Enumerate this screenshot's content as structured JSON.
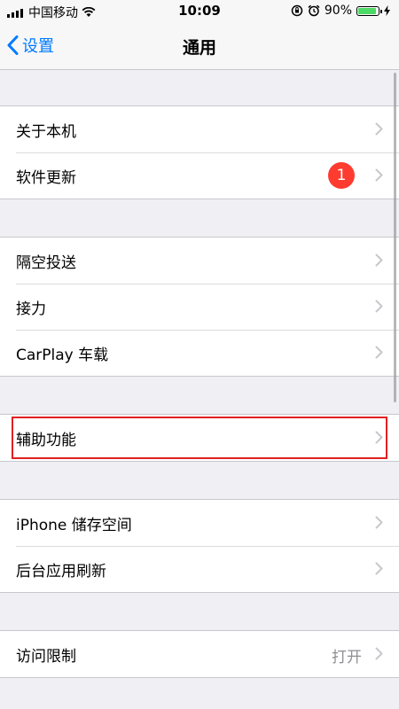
{
  "status_bar": {
    "carrier": "中国移动",
    "time": "10:09",
    "battery_text": "90%",
    "battery_level": 0.9
  },
  "nav": {
    "back_label": "设置",
    "title": "通用"
  },
  "groups": [
    {
      "items": [
        {
          "label": "关于本机"
        },
        {
          "label": "软件更新",
          "badge": "1"
        }
      ]
    },
    {
      "items": [
        {
          "label": "隔空投送"
        },
        {
          "label": "接力"
        },
        {
          "label": "CarPlay 车载"
        }
      ]
    },
    {
      "items": [
        {
          "label": "辅助功能",
          "highlighted": true
        }
      ]
    },
    {
      "items": [
        {
          "label": "iPhone 储存空间"
        },
        {
          "label": "后台应用刷新"
        }
      ]
    },
    {
      "items": [
        {
          "label": "访问限制",
          "value": "打开"
        }
      ]
    }
  ],
  "colors": {
    "accent": "#007aff",
    "badge": "#ff3b30",
    "highlight": "#e02020",
    "background": "#efeff4"
  }
}
